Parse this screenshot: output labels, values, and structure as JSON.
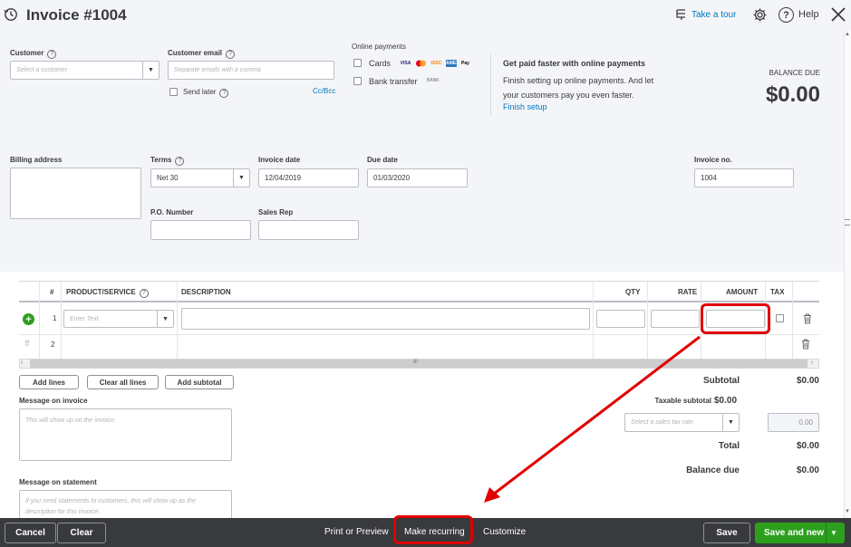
{
  "header": {
    "title": "Invoice #1004",
    "take_tour": "Take a tour",
    "help": "Help",
    "accent": "#0077c5"
  },
  "customer": {
    "label": "Customer",
    "placeholder": "Select a customer"
  },
  "email": {
    "label": "Customer email",
    "placeholder": "Separate emails with a comma",
    "send_later": "Send later",
    "cc_bcc": "Cc/Bcc"
  },
  "online_payments": {
    "label": "Online payments",
    "cards": "Cards",
    "card_logos": [
      "VISA",
      "MC",
      "DISC",
      "AMEX",
      "Pay"
    ],
    "bank_transfer": "Bank transfer",
    "bank_logo": "BANK",
    "promo_title": "Get paid faster with online payments",
    "promo_text": "Finish setting up online payments. And let your customers pay you even faster.",
    "finish_setup": "Finish setup"
  },
  "balance": {
    "label": "BALANCE DUE",
    "amount": "$0.00"
  },
  "billing": {
    "label": "Billing address"
  },
  "terms": {
    "label": "Terms",
    "value": "Net 30"
  },
  "invoice_date": {
    "label": "Invoice date",
    "value": "12/04/2019"
  },
  "due_date": {
    "label": "Due date",
    "value": "01/03/2020"
  },
  "invoice_no": {
    "label": "Invoice no.",
    "value": "1004"
  },
  "po": {
    "label": "P.O. Number"
  },
  "sales_rep": {
    "label": "Sales Rep"
  },
  "table": {
    "headers": {
      "num": "#",
      "product": "PRODUCT/SERVICE",
      "description": "DESCRIPTION",
      "qty": "QTY",
      "rate": "RATE",
      "amount": "AMOUNT",
      "tax": "TAX"
    },
    "rows": [
      {
        "num": "1",
        "product_placeholder": "Enter Text"
      },
      {
        "num": "2"
      }
    ],
    "scroll_grip": "III"
  },
  "buttons": {
    "add_lines": "Add lines",
    "clear_lines": "Clear all lines",
    "add_subtotal": "Add subtotal"
  },
  "message_invoice": {
    "label": "Message on invoice",
    "placeholder": "This will show up on the invoice."
  },
  "message_statement": {
    "label": "Message on statement",
    "placeholder": "If you send statements to customers, this will show up as the description for this invoice."
  },
  "totals": {
    "subtotal_label": "Subtotal",
    "subtotal": "$0.00",
    "taxable_label": "Taxable subtotal",
    "taxable": "$0.00",
    "tax_rate_placeholder": "Select a sales tax rate",
    "tax_amount": "0.00",
    "total_label": "Total",
    "total": "$0.00",
    "balance_label": "Balance due",
    "balance": "$0.00"
  },
  "footer": {
    "cancel": "Cancel",
    "clear": "Clear",
    "print_preview": "Print or Preview",
    "make_recurring": "Make recurring",
    "customize": "Customize",
    "save": "Save",
    "save_new": "Save and new",
    "save_new_color": "#2ca01c"
  },
  "highlight_color": "#e00000"
}
